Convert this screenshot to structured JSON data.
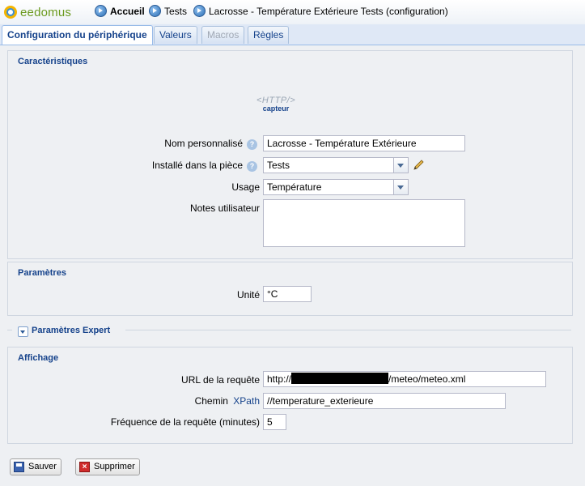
{
  "app": {
    "logo_text": "eedomus"
  },
  "breadcrumb": [
    {
      "label": "Accueil"
    },
    {
      "label": "Tests"
    },
    {
      "label": "Lacrosse - Température Extérieure Tests (configuration)"
    }
  ],
  "tabs": [
    {
      "label": "Configuration du périphérique",
      "state": "active"
    },
    {
      "label": "Valeurs",
      "state": "normal"
    },
    {
      "label": "Macros",
      "state": "disabled"
    },
    {
      "label": "Règles",
      "state": "normal"
    }
  ],
  "caracteristiques": {
    "legend": "Caractéristiques",
    "device_icon_text": "<HTTP/>",
    "device_icon_caption": "capteur",
    "nom_label": "Nom personnalisé",
    "nom_value": "Lacrosse - Température Extérieure",
    "piece_label": "Installé dans la pièce",
    "piece_value": "Tests",
    "usage_label": "Usage",
    "usage_value": "Température",
    "notes_label": "Notes utilisateur",
    "notes_value": ""
  },
  "parametres": {
    "legend": "Paramètres",
    "unite_label": "Unité",
    "unite_value": "°C"
  },
  "expert": {
    "label": "Paramètres Expert"
  },
  "affichage": {
    "legend": "Affichage",
    "url_label": "URL de la requête",
    "url_prefix": "http://",
    "url_suffix": "/meteo/meteo.xml",
    "chemin_label": "Chemin",
    "chemin_link": "XPath",
    "chemin_value": "//temperature_exterieure",
    "frequence_label": "Fréquence de la requête (minutes)",
    "frequence_value": "5"
  },
  "buttons": {
    "save": "Sauver",
    "delete": "Supprimer"
  },
  "colors": {
    "accent": "#15428b",
    "tab_bar": "#dfe8f6",
    "panel": "#eef0f3"
  }
}
